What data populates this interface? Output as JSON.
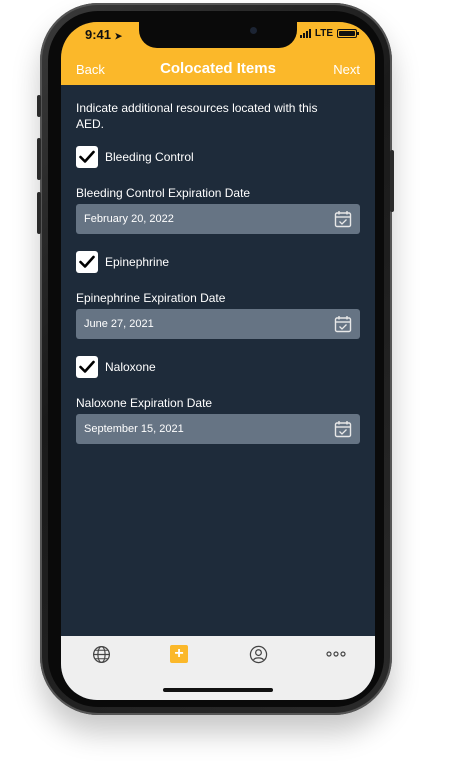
{
  "status_bar": {
    "time": "9:41",
    "network": "LTE"
  },
  "header": {
    "back_label": "Back",
    "title": "Colocated Items",
    "next_label": "Next"
  },
  "intro_text": "Indicate additional resources located with this AED.",
  "items": [
    {
      "label": "Bleeding Control",
      "checked": true,
      "date_label": "Bleeding Control Expiration Date",
      "date_value": "February 20, 2022"
    },
    {
      "label": "Epinephrine",
      "checked": true,
      "date_label": "Epinephrine Expiration Date",
      "date_value": "June 27, 2021"
    },
    {
      "label": "Naloxone",
      "checked": true,
      "date_label": "Naloxone Expiration Date",
      "date_value": "September 15, 2021"
    }
  ],
  "tabbar": {
    "icons": [
      "globe-icon",
      "add-icon",
      "user-icon",
      "more-icon"
    ],
    "add_symbol": "+"
  },
  "colors": {
    "accent": "#fbb82a",
    "background": "#1e2b3a",
    "field": "#667484"
  }
}
